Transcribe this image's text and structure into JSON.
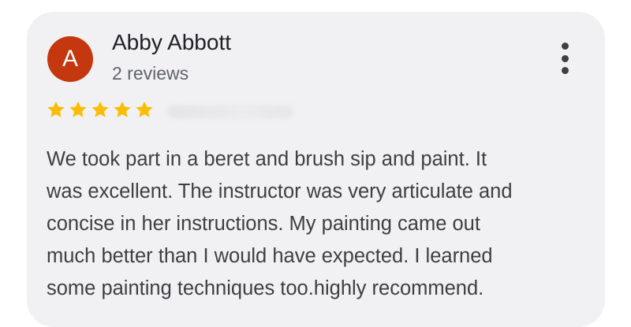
{
  "review": {
    "author": {
      "initial": "A",
      "name": "Abby Abbott",
      "review_count": "2 reviews",
      "avatar_color": "#c5370f"
    },
    "rating": 5,
    "rating_max": 5,
    "star_color": "#fbbc04",
    "menu_icon": "more-vert-icon",
    "text_lines": [
      "We took part in a beret and brush sip and paint. It",
      "was excellent. The instructor was very articulate and",
      "concise in her instructions. My painting came out",
      "much better than I would have expected. I learned",
      "some painting techniques too.highly recommend."
    ]
  }
}
